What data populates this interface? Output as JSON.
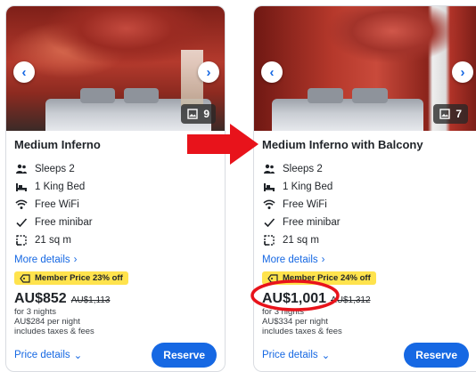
{
  "cards": [
    {
      "title": "Medium Inferno",
      "photo_count": "9",
      "features": [
        {
          "icon": "people-icon",
          "label": "Sleeps 2"
        },
        {
          "icon": "bed-icon",
          "label": "1 King Bed"
        },
        {
          "icon": "wifi-icon",
          "label": "Free WiFi"
        },
        {
          "icon": "check-icon",
          "label": "Free minibar"
        },
        {
          "icon": "area-icon",
          "label": "21 sq m"
        }
      ],
      "more_details": "More details",
      "badge": "Member Price 23% off",
      "price": "AU$852",
      "original_price": "AU$1,113",
      "sub_lines": [
        "for 3 nights",
        "AU$284 per night",
        "includes taxes & fees"
      ],
      "price_details": "Price details",
      "reserve": "Reserve"
    },
    {
      "title": "Medium Inferno with Balcony",
      "photo_count": "7",
      "features": [
        {
          "icon": "people-icon",
          "label": "Sleeps 2"
        },
        {
          "icon": "bed-icon",
          "label": "1 King Bed"
        },
        {
          "icon": "wifi-icon",
          "label": "Free WiFi"
        },
        {
          "icon": "check-icon",
          "label": "Free minibar"
        },
        {
          "icon": "area-icon",
          "label": "21 sq m"
        }
      ],
      "more_details": "More details",
      "badge": "Member Price 24% off",
      "price": "AU$1,001",
      "original_price": "AU$1,312",
      "sub_lines": [
        "for 3 nights",
        "AU$334 per night",
        "includes taxes & fees"
      ],
      "price_details": "Price details",
      "reserve": "Reserve"
    }
  ],
  "colors": {
    "link": "#1668e3",
    "badge": "#ffe34d",
    "annotation": "#e8131b"
  }
}
